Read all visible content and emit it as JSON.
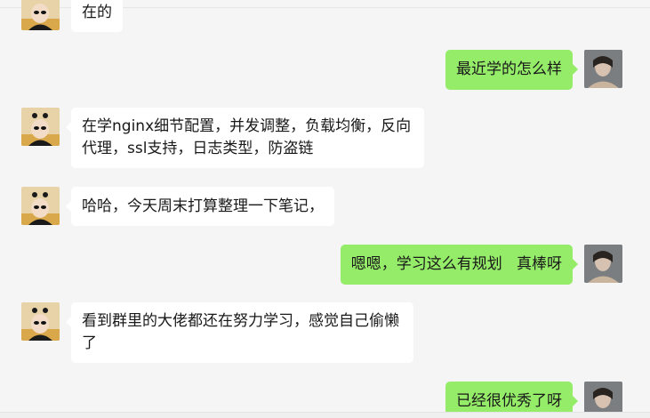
{
  "colors": {
    "background": "#f5f5f5",
    "incoming_bubble": "#ffffff",
    "outgoing_bubble": "#95ec69",
    "text": "#191919"
  },
  "messages": [
    {
      "sender": "friend",
      "text": "在的"
    },
    {
      "sender": "me",
      "text": "最近学的怎么样"
    },
    {
      "sender": "friend",
      "text": "在学nginx细节配置，并发调整，负载均衡，反向代理，ssl支持，日志类型，防盗链"
    },
    {
      "sender": "friend",
      "text": "哈哈，今天周末打算整理一下笔记，"
    },
    {
      "sender": "me",
      "text": "嗯嗯，学习这么有规划   真棒呀"
    },
    {
      "sender": "friend",
      "text": "看到群里的大佬都还在努力学习，感觉自己偷懒了"
    },
    {
      "sender": "me",
      "text": "已经很优秀了呀"
    }
  ]
}
